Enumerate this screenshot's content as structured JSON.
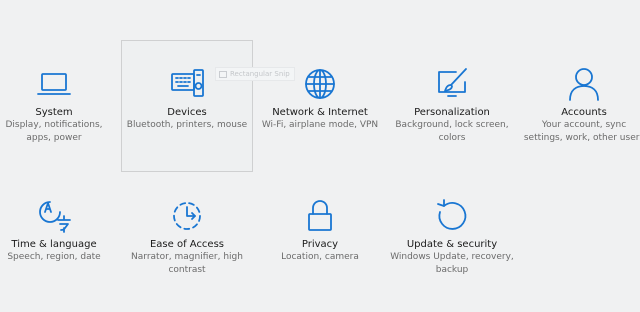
{
  "accent_color": "#1976d2",
  "tiles": [
    {
      "title": "System",
      "desc": "Display, notifications, apps, power",
      "icon": "laptop-icon"
    },
    {
      "title": "Devices",
      "desc": "Bluetooth, printers, mouse",
      "icon": "devices-icon"
    },
    {
      "title": "Network & Internet",
      "desc": "Wi-Fi, airplane mode, VPN",
      "icon": "globe-icon"
    },
    {
      "title": "Personalization",
      "desc": "Background, lock screen, colors",
      "icon": "paintbrush-icon"
    },
    {
      "title": "Accounts",
      "desc": "Your account, sync settings, work, other users",
      "icon": "person-icon"
    },
    {
      "title": "Time & language",
      "desc": "Speech, region, date",
      "icon": "time-language-icon"
    },
    {
      "title": "Ease of Access",
      "desc": "Narrator, magnifier, high contrast",
      "icon": "ease-of-access-icon"
    },
    {
      "title": "Privacy",
      "desc": "Location, camera",
      "icon": "lock-icon"
    },
    {
      "title": "Update & security",
      "desc": "Windows Update, recovery, backup",
      "icon": "refresh-icon"
    }
  ],
  "tooltip": {
    "text": "Rectangular Snip"
  }
}
